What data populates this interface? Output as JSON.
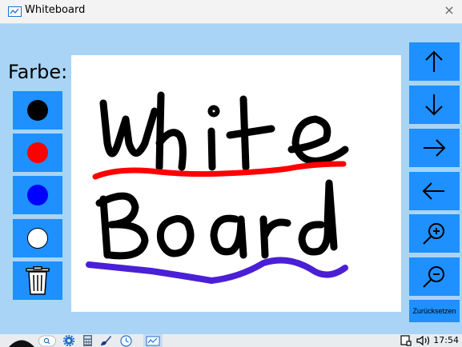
{
  "window": {
    "title": "Whiteboard",
    "close_glyph": "×"
  },
  "sidebar": {
    "label": "Farbe:",
    "colors": [
      {
        "name": "black",
        "hex": "#000000"
      },
      {
        "name": "red",
        "hex": "#ff0000"
      },
      {
        "name": "blue",
        "hex": "#0000ff"
      },
      {
        "name": "white",
        "hex": "#ffffff"
      }
    ],
    "trash_icon": "trash-icon"
  },
  "canvas": {
    "drawn_text": [
      "White",
      "Board"
    ],
    "stroke_colors": {
      "ink": "#000000",
      "red": "#ff0000",
      "purple": "#4a1fd6"
    }
  },
  "navigation": {
    "buttons": [
      "arrow-up-icon",
      "arrow-down-icon",
      "arrow-right-icon",
      "arrow-left-icon",
      "zoom-in-icon",
      "zoom-out-icon"
    ],
    "reset_label": "Zurücksetzen"
  },
  "taskbar": {
    "clock": "17:54",
    "icons": [
      "start-icon",
      "search-icon",
      "settings-icon",
      "calculator-icon",
      "paint-icon",
      "clock-app-icon",
      "whiteboard-app-icon",
      "notes-icon",
      "volume-icon"
    ]
  },
  "colors": {
    "accent": "#1e90ff",
    "background": "#a9d4f5"
  }
}
